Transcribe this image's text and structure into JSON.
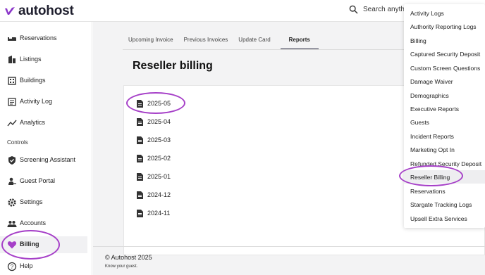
{
  "app": {
    "name": "autohost"
  },
  "search": {
    "placeholder": "Search anythin"
  },
  "sidebar": {
    "items": [
      {
        "label": "Reservations",
        "icon": "bed-icon"
      },
      {
        "label": "Listings",
        "icon": "building-icon"
      },
      {
        "label": "Buildings",
        "icon": "apartment-icon"
      },
      {
        "label": "Activity Log",
        "icon": "list-icon"
      },
      {
        "label": "Analytics",
        "icon": "trending-icon"
      }
    ],
    "section_label": "Controls",
    "controls": [
      {
        "label": "Screening Assistant",
        "icon": "shield-icon"
      },
      {
        "label": "Guest Portal",
        "icon": "person-key-icon"
      },
      {
        "label": "Settings",
        "icon": "gear-icon"
      },
      {
        "label": "Accounts",
        "icon": "people-icon"
      },
      {
        "label": "Billing",
        "icon": "heart-icon",
        "active": true
      },
      {
        "label": "Help",
        "icon": "help-icon"
      }
    ]
  },
  "tabs": [
    {
      "label": "Upcoming Invoice"
    },
    {
      "label": "Previous Invoices"
    },
    {
      "label": "Update Card"
    },
    {
      "label": "Reports",
      "active": true
    }
  ],
  "page_title": "Reseller billing",
  "files": [
    "2025-05",
    "2025-04",
    "2025-03",
    "2025-02",
    "2025-01",
    "2024-12",
    "2024-11"
  ],
  "footer": {
    "copyright": "© Autohost 2025",
    "tagline": "Know your guest."
  },
  "reports_menu": {
    "items": [
      "Activity Logs",
      "Authority Reporting Logs",
      "Billing",
      "Captured Security Deposit",
      "Custom Screen Questions",
      "Damage Waiver",
      "Demographics",
      "Executive Reports",
      "Guests",
      "Incident Reports",
      "Marketing Opt In",
      "Refunded Security Deposit",
      "Reseller Billing",
      "Reservations",
      "Stargate Tracking Logs",
      "Upsell Extra Services"
    ],
    "highlighted": "Reseller Billing"
  },
  "colors": {
    "accent": "#a640c8",
    "brand": "#1e1e2d",
    "logo": "#8a35c9"
  }
}
